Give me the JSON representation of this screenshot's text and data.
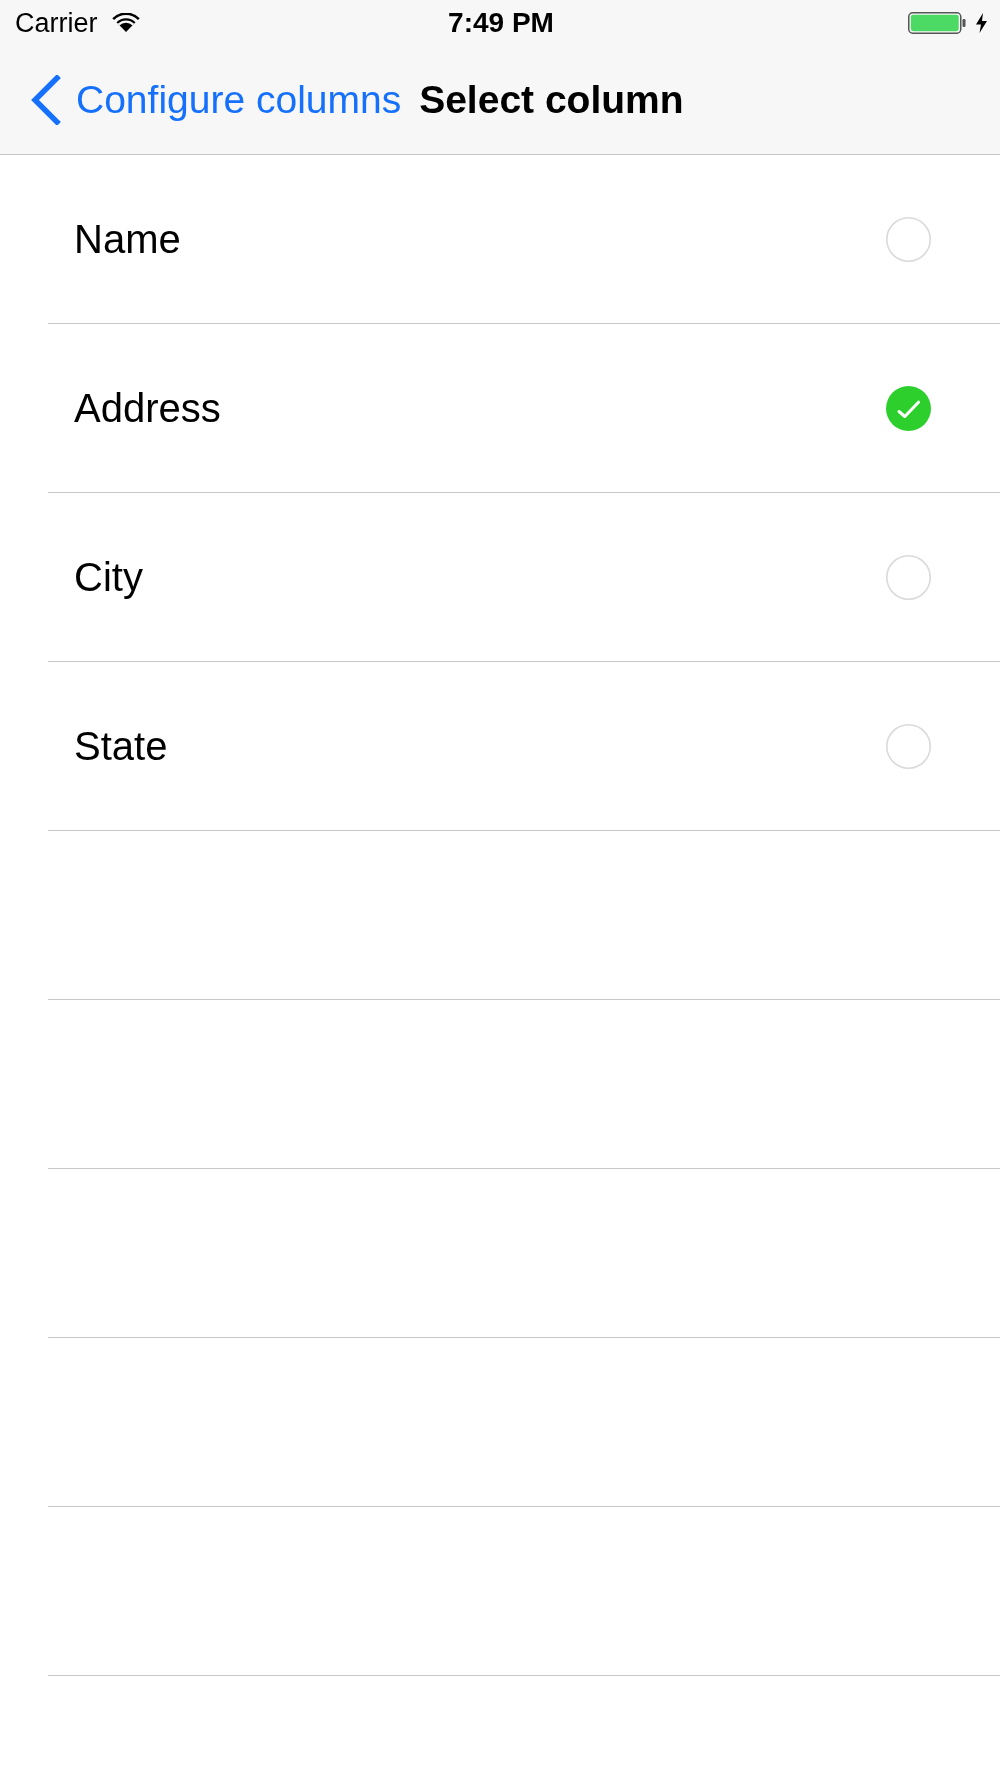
{
  "status_bar": {
    "carrier": "Carrier",
    "time": "7:49 PM"
  },
  "navigation_bar": {
    "back_label": "Configure columns",
    "title": "Select column"
  },
  "columns": [
    {
      "label": "Name",
      "selected": false
    },
    {
      "label": "Address",
      "selected": true
    },
    {
      "label": "City",
      "selected": false
    },
    {
      "label": "State",
      "selected": false
    }
  ]
}
